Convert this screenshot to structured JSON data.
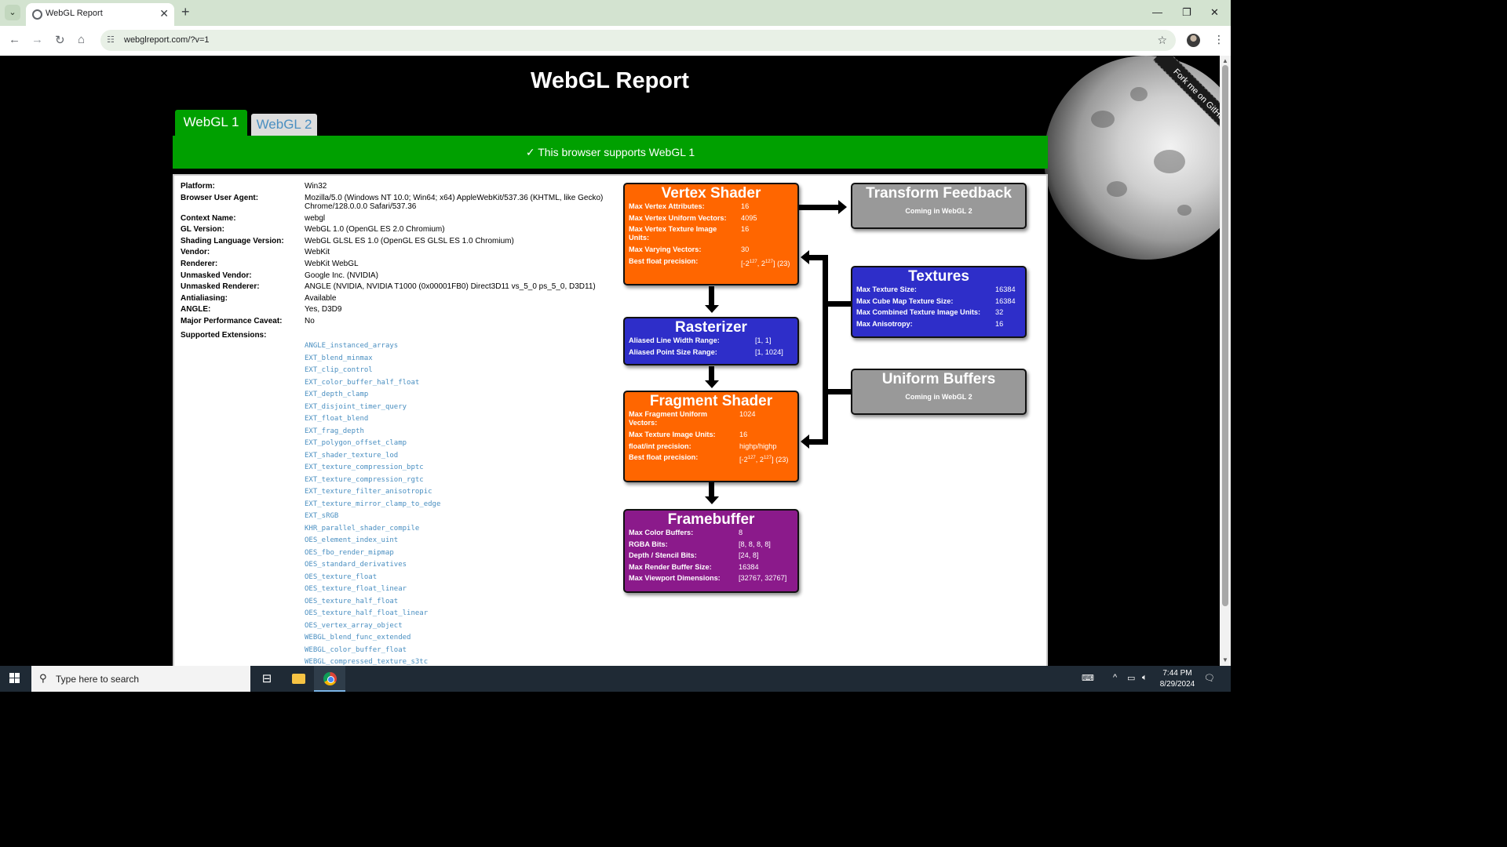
{
  "browser": {
    "tab_title": "WebGL Report",
    "url": "webglreport.com/?v=1",
    "new_tab_symbol": "+",
    "close_symbol": "✕"
  },
  "page": {
    "title": "WebGL Report",
    "github_ribbon": "Fork me on GitHub",
    "tabs": [
      {
        "label": "WebGL 1"
      },
      {
        "label": "WebGL 2"
      }
    ],
    "support_message": "✓ This browser supports WebGL 1"
  },
  "info": [
    {
      "key": "Platform:",
      "value": "Win32"
    },
    {
      "key": "Browser User Agent:",
      "value": "Mozilla/5.0 (Windows NT 10.0; Win64; x64) AppleWebKit/537.36 (KHTML, like Gecko) Chrome/128.0.0.0 Safari/537.36"
    },
    {
      "key": "Context Name:",
      "value": "webgl"
    },
    {
      "key": "GL Version:",
      "value": "WebGL 1.0 (OpenGL ES 2.0 Chromium)"
    },
    {
      "key": "Shading Language Version:",
      "value": "WebGL GLSL ES 1.0 (OpenGL ES GLSL ES 1.0 Chromium)"
    },
    {
      "key": "Vendor:",
      "value": "WebKit"
    },
    {
      "key": "Renderer:",
      "value": "WebKit WebGL"
    },
    {
      "key": "Unmasked Vendor:",
      "value": "Google Inc. (NVIDIA)"
    },
    {
      "key": "Unmasked Renderer:",
      "value": "ANGLE (NVIDIA, NVIDIA T1000 (0x00001FB0) Direct3D11 vs_5_0 ps_5_0, D3D11)"
    },
    {
      "key": "Antialiasing:",
      "value": "Available"
    },
    {
      "key": "ANGLE:",
      "value": "Yes, D3D9"
    },
    {
      "key": "Major Performance Caveat:",
      "value": "No"
    }
  ],
  "extensions_label": "Supported Extensions:",
  "extensions": [
    "ANGLE_instanced_arrays",
    "EXT_blend_minmax",
    "EXT_clip_control",
    "EXT_color_buffer_half_float",
    "EXT_depth_clamp",
    "EXT_disjoint_timer_query",
    "EXT_float_blend",
    "EXT_frag_depth",
    "EXT_polygon_offset_clamp",
    "EXT_shader_texture_lod",
    "EXT_texture_compression_bptc",
    "EXT_texture_compression_rgtc",
    "EXT_texture_filter_anisotropic",
    "EXT_texture_mirror_clamp_to_edge",
    "EXT_sRGB",
    "KHR_parallel_shader_compile",
    "OES_element_index_uint",
    "OES_fbo_render_mipmap",
    "OES_standard_derivatives",
    "OES_texture_float",
    "OES_texture_float_linear",
    "OES_texture_half_float",
    "OES_texture_half_float_linear",
    "OES_vertex_array_object",
    "WEBGL_blend_func_extended",
    "WEBGL_color_buffer_float",
    "WEBGL_compressed_texture_s3tc"
  ],
  "pipeline": {
    "vertex": {
      "title": "Vertex Shader",
      "rows": [
        {
          "label": "Max Vertex Attributes:",
          "value": "16"
        },
        {
          "label": "Max Vertex Uniform Vectors:",
          "value": "4095"
        },
        {
          "label": "Max Vertex Texture Image Units:",
          "value": "16"
        },
        {
          "label": "Max Varying Vectors:",
          "value": "30"
        },
        {
          "label": "Best float precision:",
          "value": "[-2^127, 2^127] (23)"
        }
      ]
    },
    "rasterizer": {
      "title": "Rasterizer",
      "rows": [
        {
          "label": "Aliased Line Width Range:",
          "value": "[1, 1]"
        },
        {
          "label": "Aliased Point Size Range:",
          "value": "[1, 1024]"
        }
      ]
    },
    "fragment": {
      "title": "Fragment Shader",
      "rows": [
        {
          "label": "Max Fragment Uniform Vectors:",
          "value": "1024"
        },
        {
          "label": "Max Texture Image Units:",
          "value": "16"
        },
        {
          "label": "float/int precision:",
          "value": "highp/highp"
        },
        {
          "label": "Best float precision:",
          "value": "[-2^127, 2^127] (23)"
        }
      ]
    },
    "framebuffer": {
      "title": "Framebuffer",
      "rows": [
        {
          "label": "Max Color Buffers:",
          "value": "8"
        },
        {
          "label": "RGBA Bits:",
          "value": "[8, 8, 8, 8]"
        },
        {
          "label": "Depth / Stencil Bits:",
          "value": "[24, 8]"
        },
        {
          "label": "Max Render Buffer Size:",
          "value": "16384"
        },
        {
          "label": "Max Viewport Dimensions:",
          "value": "[32767, 32767]"
        }
      ]
    },
    "transform_feedback": {
      "title": "Transform Feedback",
      "note": "Coming in WebGL 2"
    },
    "textures": {
      "title": "Textures",
      "rows": [
        {
          "label": "Max Texture Size:",
          "value": "16384"
        },
        {
          "label": "Max Cube Map Texture Size:",
          "value": "16384"
        },
        {
          "label": "Max Combined Texture Image Units:",
          "value": "32"
        },
        {
          "label": "Max Anisotropy:",
          "value": "16"
        }
      ]
    },
    "uniform_buffers": {
      "title": "Uniform Buffers",
      "note": "Coming in WebGL 2"
    }
  },
  "taskbar": {
    "search_placeholder": "Type here to search",
    "time": "7:44 PM",
    "date": "8/29/2024"
  },
  "colors": {
    "green": "#00a000",
    "orange": "#ff6600",
    "blue": "#2e2ec9",
    "purple": "#8b1a8b",
    "gray": "#999999",
    "link": "#4a8fc1"
  }
}
